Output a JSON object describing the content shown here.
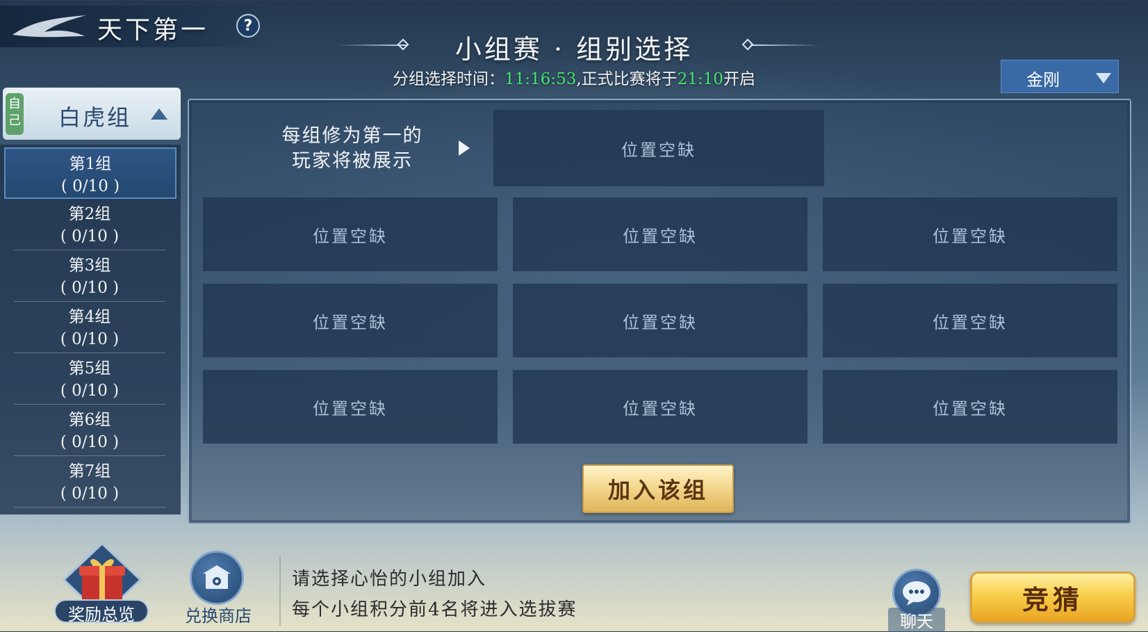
{
  "header": {
    "game_title": "天下第一",
    "help_label": "?",
    "page_title": "小组赛 · 组别选择",
    "time_prefix": "分组选择时间：",
    "countdown": "11:16:53",
    "time_mid": ",正式比赛将于",
    "start_time": "21:10",
    "time_suffix": "开启"
  },
  "weapon_dropdown": {
    "selected": "金刚"
  },
  "sidebar": {
    "own_badge": "自己",
    "group_header": "白虎组",
    "items": [
      {
        "label": "第1组",
        "count": "( 0/10 )",
        "selected": true
      },
      {
        "label": "第2组",
        "count": "( 0/10 )"
      },
      {
        "label": "第3组",
        "count": "( 0/10 )"
      },
      {
        "label": "第4组",
        "count": "( 0/10 )"
      },
      {
        "label": "第5组",
        "count": "( 0/10 )"
      },
      {
        "label": "第6组",
        "count": "( 0/10 )"
      },
      {
        "label": "第7组",
        "count": "( 0/10 )"
      }
    ]
  },
  "main": {
    "top_note_line1": "每组修为第一的",
    "top_note_line2": "玩家将被展示",
    "top_slot": "位置空缺",
    "slots": [
      "位置空缺",
      "位置空缺",
      "位置空缺",
      "位置空缺",
      "位置空缺",
      "位置空缺",
      "位置空缺",
      "位置空缺",
      "位置空缺"
    ],
    "join_button": "加入该组"
  },
  "footer": {
    "rewards_label": "奖励总览",
    "shop_label": "兑换商店",
    "hint_line1": "请选择心怡的小组加入",
    "hint_line2": "每个小组积分前4名将进入选拔赛",
    "chat_label": "聊天",
    "guess_button": "竞猜"
  },
  "colors": {
    "accent_green": "#46e46e",
    "selected_blue": "#2f5585",
    "gold": "#f2d68a"
  }
}
